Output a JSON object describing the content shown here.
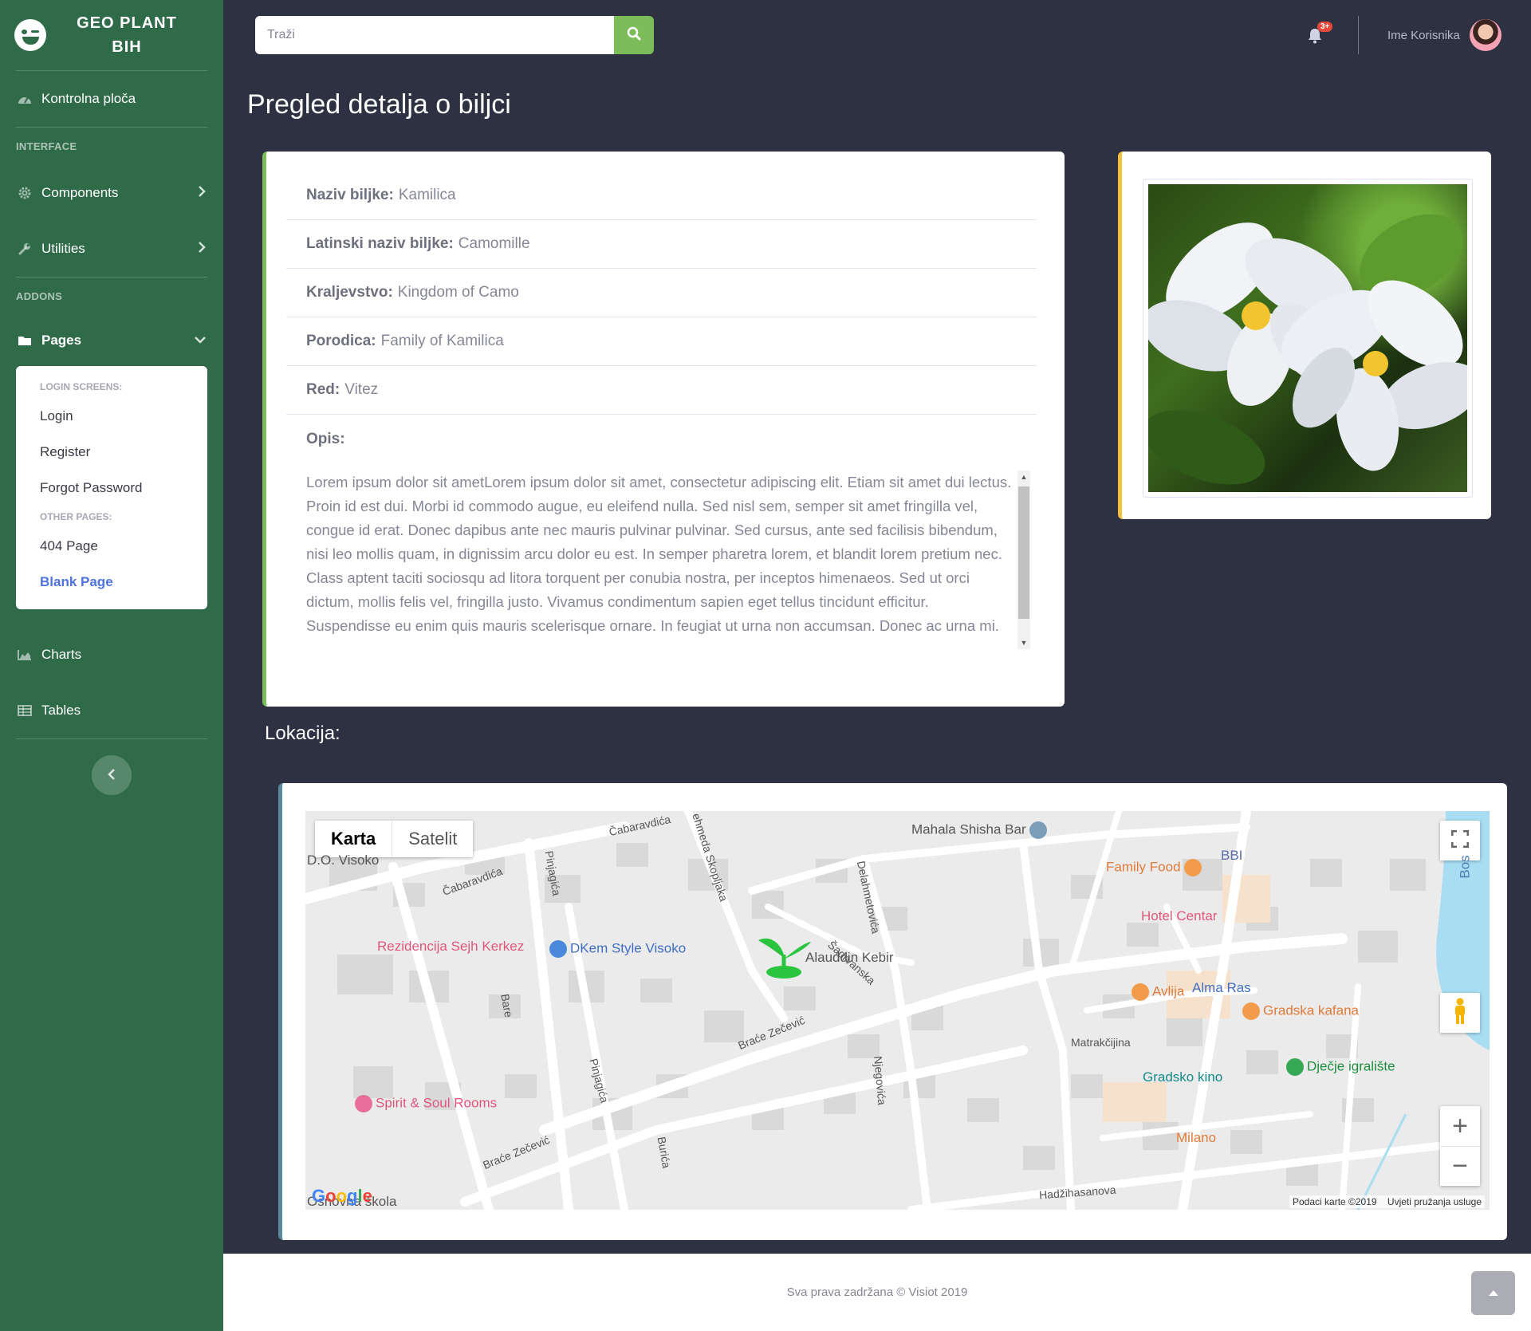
{
  "brand": {
    "title_line1": "GEO PLANT",
    "title_line2": "BIH"
  },
  "sidebar": {
    "dashboard": "Kontrolna ploča",
    "section_interface": "INTERFACE",
    "components": "Components",
    "utilities": "Utilities",
    "section_addons": "ADDONS",
    "pages": "Pages",
    "collapse": {
      "header_login": "LOGIN SCREENS:",
      "login": "Login",
      "register": "Register",
      "forgot": "Forgot Password",
      "header_other": "OTHER PAGES:",
      "p404": "404 Page",
      "blank": "Blank Page"
    },
    "charts": "Charts",
    "tables": "Tables"
  },
  "topbar": {
    "search_placeholder": "Traži",
    "alerts_badge": "3+",
    "user_name": "Ime Korisnika"
  },
  "page": {
    "title": "Pregled detalja o biljci"
  },
  "plant": {
    "name_label": "Naziv biljke:",
    "name_value": "Kamilica",
    "latin_label": "Latinski naziv biljke:",
    "latin_value": "Camomille",
    "kingdom_label": "Kraljevstvo:",
    "kingdom_value": "Kingdom of Camo",
    "family_label": "Porodica:",
    "family_value": "Family of Kamilica",
    "order_label": "Red:",
    "order_value": "Vitez",
    "desc_label": "Opis:",
    "desc_value": "Lorem ipsum dolor sit ametLorem ipsum dolor sit amet, consectetur adipiscing elit. Etiam sit amet dui lectus. Proin id est dui. Morbi id commodo augue, eu eleifend nulla. Sed nisl sem, semper sit amet fringilla vel, congue id erat. Donec dapibus ante nec mauris pulvinar pulvinar. Sed cursus, ante sed facilisis bibendum, nisi leo mollis quam, in dignissim arcu dolor eu est. In semper pharetra lorem, et blandit lorem pretium nec. Class aptent taciti sociosqu ad litora torquent per conubia nostra, per inceptos himenaeos. Sed ut orci dictum, mollis felis vel, fringilla justo. Vivamus condimentum sapien eget tellus tincidunt efficitur. Suspendisse eu enim quis mauris scelerisque ornare. In feugiat ut urna non accumsan. Donec ac urna mi."
  },
  "location": {
    "title": "Lokacija:",
    "map": {
      "tab_map": "Karta",
      "tab_satellite": "Satelit",
      "attribution_data": "Podaci karte ©2019",
      "attribution_terms": "Uvjeti pružanja usluge",
      "google": "Google",
      "pois": {
        "mahala": "Mahala Shisha Bar",
        "family_food": "Family Food",
        "bbi": "BBI",
        "hotel": "Hotel Centar",
        "rezidencija": "Rezidencija Sejh Kerkez",
        "dkem": "DKem Style Visoko",
        "alauddin": "Alauddin Kebir",
        "avlija": "Avlija",
        "alma": "Alma Ras",
        "gradska": "Gradska kafana",
        "kino": "Gradsko kino",
        "igraliste": "Dječje igralište",
        "milano": "Milano",
        "spirit": "Spirit & Soul Rooms",
        "skola": "Osnovna škola",
        "visoko": "D.O. Visoko",
        "bos": "Bos"
      },
      "streets": {
        "cabaravdica1": "Čabaravdića",
        "cabaravdica2": "Čabaravdića",
        "pinjagica1": "Pinjagića",
        "pinjagica2": "Pinjagića",
        "skopljaka": "ehmeda Skopljaka",
        "delahmetovica": "Delahmetovića",
        "sadrvanska": "Šadrvanska",
        "bare": "Bare",
        "brace1": "Braće Zečević",
        "brace2": "Braće Zečević",
        "matrakcijina": "Matrakčijina",
        "njegoviza": "Njegovića",
        "burica": "Burića",
        "hadzihasanova": "Hadžihasanova"
      }
    }
  },
  "footer": {
    "copyright": "Sva prava zadržana © Visiot 2019"
  },
  "colors": {
    "sidebar": "#2f6b48",
    "background": "#2d3142",
    "accent_green": "#7cbd5a",
    "accent_yellow": "#f6c23e",
    "link_blue": "#4e73df"
  }
}
